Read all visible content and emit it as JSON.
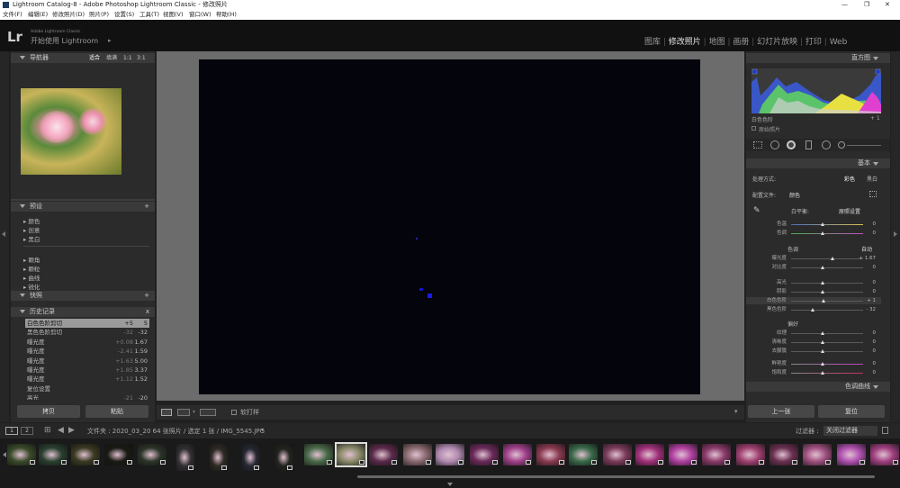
{
  "window": {
    "title": "Lightroom Catalog-8 - Adobe Photoshop Lightroom Classic - 修改照片"
  },
  "menu": [
    "文件(F)",
    "编辑(E)",
    "修改照片(D)",
    "照片(P)",
    "设置(S)",
    "工具(T)",
    "视图(V)",
    "窗口(W)",
    "帮助(H)"
  ],
  "identity": {
    "logo": "Lr",
    "product": "Adobe Lightroom Classic",
    "start": "开始使用 Lightroom",
    "arrow": "▸"
  },
  "modules": [
    "图库",
    "修改照片",
    "地图",
    "画册",
    "幻灯片放映",
    "打印",
    "Web"
  ],
  "navigator": {
    "title": "导航器",
    "zoom": [
      "适合",
      "填满",
      "1:1",
      "3:1"
    ]
  },
  "presets": {
    "title": "预设",
    "add": "+",
    "items": [
      "颜色",
      "创意",
      "黑白",
      "颗角",
      "颗粒",
      "曲线",
      "锐化"
    ]
  },
  "snapshots": {
    "title": "快照",
    "add": "+"
  },
  "history": {
    "title": "历史记录",
    "close": "x",
    "rows": [
      {
        "label": "白色色阶剪切",
        "a": "+5",
        "b": "5"
      },
      {
        "label": "黑色色阶剪切",
        "a": "-32",
        "b": "-32"
      },
      {
        "label": "曝光度",
        "a": "+0.08",
        "b": "1.67"
      },
      {
        "label": "曝光度",
        "a": "-2.41",
        "b": "1.59"
      },
      {
        "label": "曝光度",
        "a": "+1.63",
        "b": "5.00"
      },
      {
        "label": "曝光度",
        "a": "+1.85",
        "b": "3.37"
      },
      {
        "label": "曝光度",
        "a": "+1.12",
        "b": "1.52"
      },
      {
        "label": "复位设置",
        "a": "",
        "b": ""
      },
      {
        "label": "高光",
        "a": "-21",
        "b": "-20"
      }
    ]
  },
  "left_buttons": {
    "copy": "拷贝",
    "paste": "粘贴"
  },
  "toolbar": {
    "soft_proof": "软打样"
  },
  "histogram": {
    "title": "直方图",
    "label": "白色色阶",
    "value": "+ 1",
    "original": "原始照片"
  },
  "basic": {
    "title": "基本",
    "treatment_label": "处理方式:",
    "treatment_color": "彩色",
    "treatment_bw": "黑白",
    "profile_label": "配置文件:",
    "profile_value": "颜色",
    "wb_label": "白平衡:",
    "wb_value": "原照设置",
    "temp_label": "色温",
    "temp_value": "0",
    "tint_label": "色调",
    "tint_value": "0",
    "tone_label": "色调",
    "auto": "自动",
    "tone": [
      {
        "label": "曝光度",
        "value": "+ 1.67"
      },
      {
        "label": "对比度",
        "value": "0"
      },
      {
        "label": "高光",
        "value": "0"
      },
      {
        "label": "阴影",
        "value": "0"
      },
      {
        "label": "白色色阶",
        "value": "+ 1"
      },
      {
        "label": "黑色色阶",
        "value": "- 32"
      }
    ],
    "presence_label": "偏好",
    "presence": [
      {
        "label": "纹理",
        "value": "0"
      },
      {
        "label": "清晰度",
        "value": "0"
      },
      {
        "label": "去朦胧",
        "value": "0"
      },
      {
        "label": "鲜艳度",
        "value": "0"
      },
      {
        "label": "饱和度",
        "value": "0"
      }
    ],
    "curve_title": "色调曲线"
  },
  "right_buttons": {
    "previous": "上一张",
    "reset": "复位"
  },
  "filmstrip": {
    "pages": [
      "1",
      "2"
    ],
    "info": "文件夹 : 2020_03_20   64 张照片 / 选定 1 张 / IMG_5545.JPG",
    "filter_label": "过滤器 :",
    "filter_value": "关闭过滤器"
  }
}
